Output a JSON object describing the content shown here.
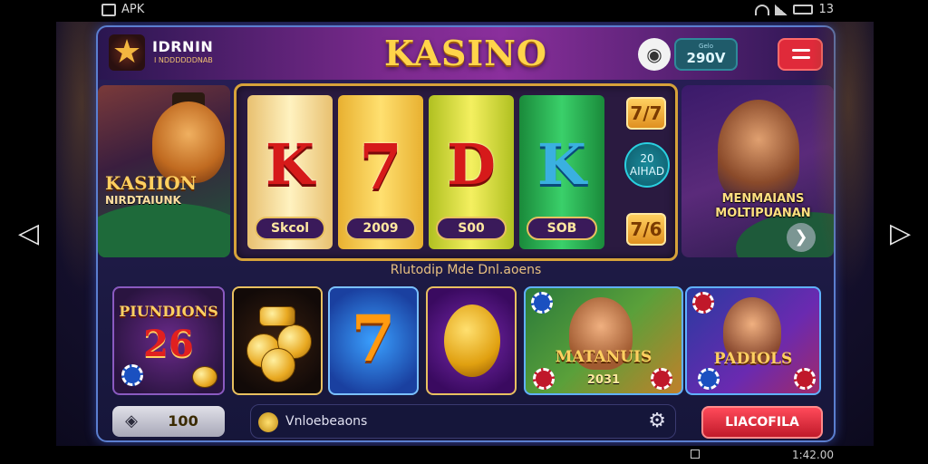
{
  "status_bar": {
    "left_label": "APK",
    "right_label": "13",
    "icons": [
      "app-icon",
      "wifi-icon",
      "signal-icon",
      "battery-icon"
    ]
  },
  "header": {
    "brand_name": "IDRNIN",
    "brand_sub": "I NDDDDDDNAB",
    "title": "KASINO",
    "balance_caption": "Gelo",
    "balance_amount": "290V",
    "icons": [
      "star-logo-icon",
      "chat-icon",
      "menu-icon"
    ]
  },
  "banner_left": {
    "title": "KASIION",
    "subtitle": "NIRDTAIUNK"
  },
  "slot_machine": {
    "reels": [
      {
        "symbol": "K",
        "badge": "Skcol"
      },
      {
        "symbol": "7",
        "badge": "2009"
      },
      {
        "symbol": "D",
        "badge": "S00"
      },
      {
        "symbol": "K",
        "badge": "SOB"
      }
    ],
    "side_top": "7/7",
    "side_mid": "20 AIHAD",
    "side_bottom": "7/6"
  },
  "banner_right": {
    "title": "MENMAIANS MOLTIPUANAN"
  },
  "section_label": "Rlutodip Mde Dnl.aoens",
  "tiles": [
    {
      "title": "PIUNDIONS",
      "number": "26"
    },
    {
      "name": "coins"
    },
    {
      "symbol": "7"
    },
    {
      "name": "golden-shield"
    },
    {
      "title": "MATANUIS",
      "subtitle": "2031"
    },
    {
      "title": "PADIOLS"
    }
  ],
  "bottom": {
    "left_value": "100",
    "search_text": "Vnloebeaons",
    "cta_label": "LIACOFILA"
  },
  "system_bar": {
    "right_text": "1:42.00"
  },
  "colors": {
    "accent_gold": "#ffd44a",
    "panel_border": "#5b7fd0",
    "cta_red": "#e02a3a",
    "balance_teal": "#1f5b6a"
  }
}
